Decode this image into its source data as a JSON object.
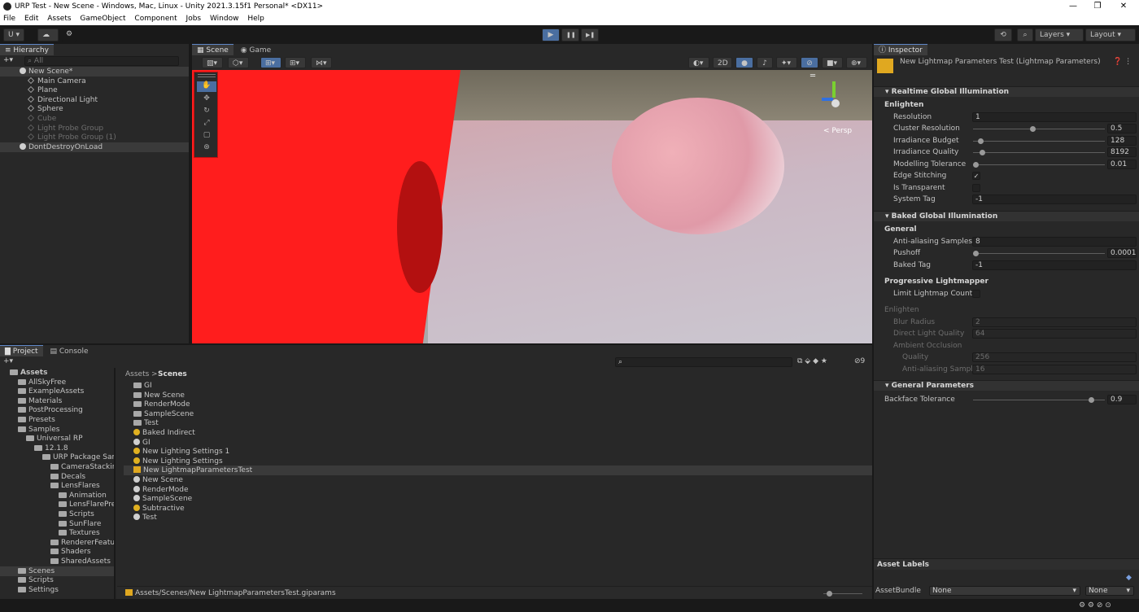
{
  "window": {
    "title": "URP Test - New Scene - Windows, Mac, Linux - Unity 2021.3.15f1 Personal* <DX11>",
    "min": "—",
    "max": "❐",
    "close": "✕"
  },
  "menu": [
    "File",
    "Edit",
    "Assets",
    "GameObject",
    "Component",
    "Jobs",
    "Window",
    "Help"
  ],
  "toolbar": {
    "account": "U ▾",
    "play": "▶",
    "pause": "❚❚",
    "step": "▶❚",
    "layers": "Layers",
    "layout": "Layout"
  },
  "hierarchy": {
    "tab": "Hierarchy",
    "search": "All",
    "items": [
      {
        "label": "New Scene*",
        "indent": 0,
        "icon": "unity",
        "sel": true
      },
      {
        "label": "Main Camera",
        "indent": 2,
        "icon": "cube"
      },
      {
        "label": "Plane",
        "indent": 2,
        "icon": "cube"
      },
      {
        "label": "Directional Light",
        "indent": 2,
        "icon": "cube"
      },
      {
        "label": "Sphere",
        "indent": 2,
        "icon": "cube"
      },
      {
        "label": "Cube",
        "indent": 2,
        "icon": "cube",
        "dim": true
      },
      {
        "label": "Light Probe Group",
        "indent": 2,
        "icon": "cube",
        "dim": true
      },
      {
        "label": "Light Probe Group (1)",
        "indent": 2,
        "icon": "cube",
        "dim": true
      },
      {
        "label": "DontDestroyOnLoad",
        "indent": 0,
        "icon": "unity",
        "sel": true
      }
    ]
  },
  "scene": {
    "tab_scene": "Scene",
    "tab_game": "Game",
    "btn_2d": "2D",
    "persp": "< Persp"
  },
  "inspector": {
    "tab": "Inspector",
    "object_title": "New Lightmap Parameters Test (Lightmap Parameters)",
    "realtime": {
      "header": "Realtime Global Illumination",
      "sub": "Enlighten",
      "resolution_label": "Resolution",
      "resolution": "1",
      "cluster_label": "Cluster Resolution",
      "cluster": "0.5",
      "irr_budget_label": "Irradiance Budget",
      "irr_budget": "128",
      "irr_quality_label": "Irradiance Quality",
      "irr_quality": "8192",
      "modelling_label": "Modelling Tolerance",
      "modelling": "0.01",
      "edge_label": "Edge Stitching",
      "edge_check": "✓",
      "transparent_label": "Is Transparent",
      "systag_label": "System Tag",
      "systag": "-1"
    },
    "baked": {
      "header": "Baked Global Illumination",
      "sub": "General",
      "aa_label": "Anti-aliasing Samples",
      "aa": "8",
      "pushoff_label": "Pushoff",
      "pushoff": "0.0001",
      "bakedtag_label": "Baked Tag",
      "bakedtag": "-1"
    },
    "progressive": {
      "header": "Progressive Lightmapper",
      "limit_label": "Limit Lightmap Count"
    },
    "enlighten2": {
      "header": "Enlighten",
      "blur_label": "Blur Radius",
      "blur": "2",
      "dlq_label": "Direct Light Quality",
      "dlq": "64",
      "ao_label": "Ambient Occlusion",
      "quality_label": "Quality",
      "quality": "256",
      "aas_label": "Anti-aliasing Sample",
      "aas": "16"
    },
    "general": {
      "header": "General Parameters",
      "backface_label": "Backface Tolerance",
      "backface": "0.9"
    },
    "asset_labels": "Asset Labels",
    "asset_bundle_label": "AssetBundle",
    "bundle_value": "None",
    "variant_value": "None"
  },
  "project": {
    "tab_project": "Project",
    "tab_console": "Console",
    "hidden_count": "9",
    "breadcrumb_root": "Assets",
    "breadcrumb_sep": ">",
    "breadcrumb_current": "Scenes",
    "tree": [
      {
        "label": "Assets",
        "indent": 0,
        "bold": true
      },
      {
        "label": "AllSkyFree",
        "indent": 1
      },
      {
        "label": "ExampleAssets",
        "indent": 1
      },
      {
        "label": "Materials",
        "indent": 1
      },
      {
        "label": "PostProcessing",
        "indent": 1
      },
      {
        "label": "Presets",
        "indent": 1
      },
      {
        "label": "Samples",
        "indent": 1
      },
      {
        "label": "Universal RP",
        "indent": 2
      },
      {
        "label": "12.1.8",
        "indent": 3
      },
      {
        "label": "URP Package Sam",
        "indent": 4
      },
      {
        "label": "CameraStacking",
        "indent": 5
      },
      {
        "label": "Decals",
        "indent": 5
      },
      {
        "label": "LensFlares",
        "indent": 5
      },
      {
        "label": "Animation",
        "indent": 6
      },
      {
        "label": "LensFlarePre",
        "indent": 6
      },
      {
        "label": "Scripts",
        "indent": 6
      },
      {
        "label": "SunFlare",
        "indent": 6
      },
      {
        "label": "Textures",
        "indent": 6
      },
      {
        "label": "RendererFeatur",
        "indent": 5
      },
      {
        "label": "Shaders",
        "indent": 5
      },
      {
        "label": "SharedAssets",
        "indent": 5
      },
      {
        "label": "Scenes",
        "indent": 1,
        "sel": true
      },
      {
        "label": "Scripts",
        "indent": 1
      },
      {
        "label": "Settings",
        "indent": 1
      }
    ],
    "files": [
      {
        "label": "GI",
        "icon": "folder"
      },
      {
        "label": "New Scene",
        "icon": "folder"
      },
      {
        "label": "RenderMode",
        "icon": "folder"
      },
      {
        "label": "SampleScene",
        "icon": "folder"
      },
      {
        "label": "Test",
        "icon": "folder"
      },
      {
        "label": "Baked Indirect",
        "icon": "bulb"
      },
      {
        "label": "GI",
        "icon": "unity"
      },
      {
        "label": "New Lighting Settings 1",
        "icon": "bulb"
      },
      {
        "label": "New Lighting Settings",
        "icon": "bulb"
      },
      {
        "label": "New LightmapParametersTest",
        "icon": "map",
        "sel": true
      },
      {
        "label": "New Scene",
        "icon": "unity"
      },
      {
        "label": "RenderMode",
        "icon": "unity"
      },
      {
        "label": "SampleScene",
        "icon": "unity"
      },
      {
        "label": "Subtractive",
        "icon": "bulb"
      },
      {
        "label": "Test",
        "icon": "unity"
      }
    ],
    "footer_path": "Assets/Scenes/New LightmapParametersTest.giparams"
  }
}
